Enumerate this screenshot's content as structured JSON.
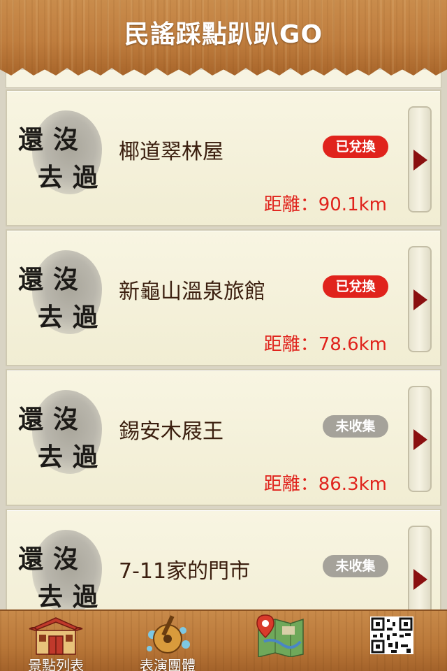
{
  "header": {
    "title": "民謠踩點趴趴GO"
  },
  "list": {
    "stamp_chars": [
      "還",
      "沒",
      "去",
      "過"
    ],
    "items": [
      {
        "name": "椰道翠林屋",
        "badge": "已兌換",
        "badge_color": "#e0231c",
        "distance": "距離：90.1km"
      },
      {
        "name": "新龜山溫泉旅館",
        "badge": "已兌換",
        "badge_color": "#e0231c",
        "distance": "距離：78.6km"
      },
      {
        "name": "錫安木屐王",
        "badge": "未收集",
        "badge_color": "#a5a29a",
        "distance": "距離：86.3km"
      },
      {
        "name": "7-11家的門市",
        "badge": "未收集",
        "badge_color": "#a5a29a",
        "distance": ""
      }
    ]
  },
  "tabbar": {
    "tabs": [
      {
        "label": "景點列表",
        "icon": "temple-icon"
      },
      {
        "label": "表演團體",
        "icon": "guitar-icon"
      },
      {
        "label": "",
        "icon": "map-icon"
      },
      {
        "label": "",
        "icon": "qr-code-icon"
      }
    ]
  }
}
